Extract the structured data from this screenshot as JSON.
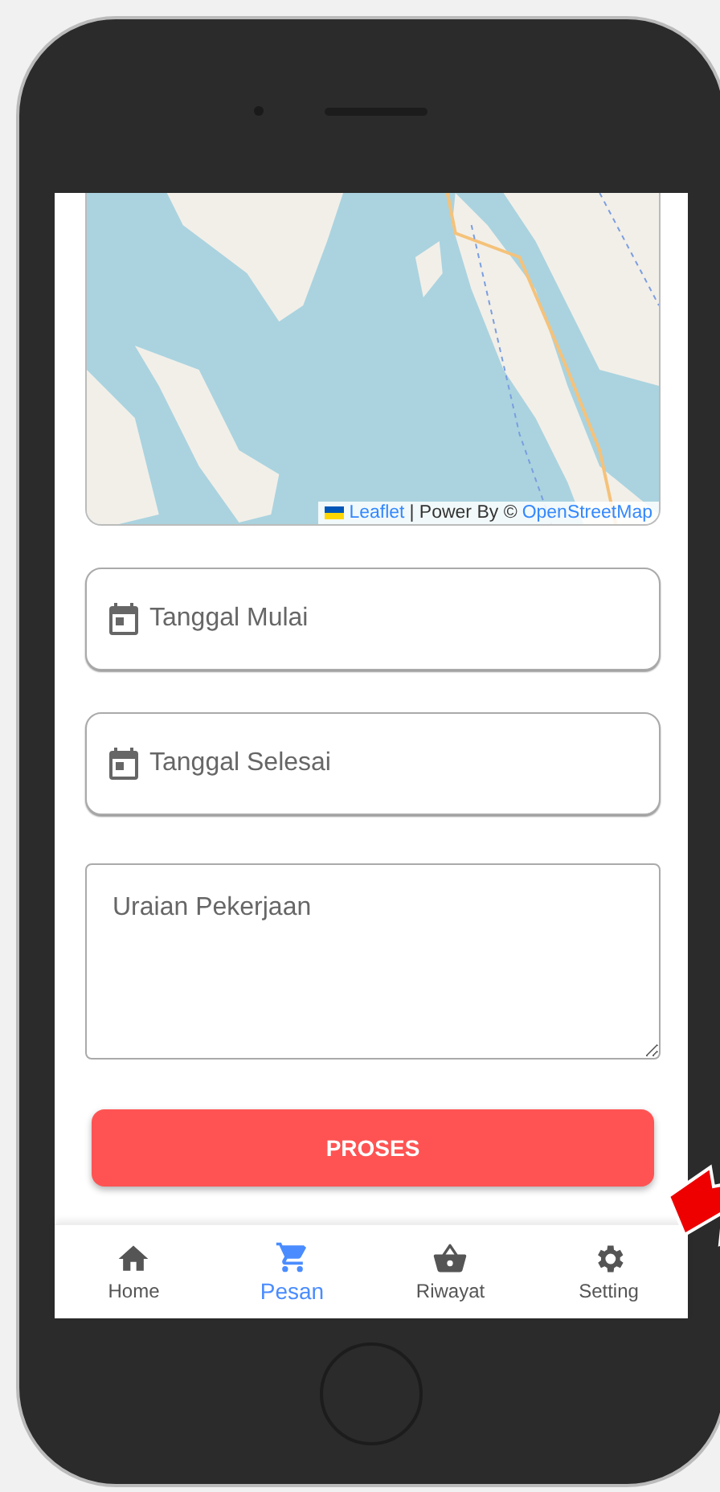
{
  "map": {
    "kind": "picture",
    "attribution": {
      "link": "Leaflet",
      "text": "| Power By ©",
      "source": "OpenStreetMap"
    }
  },
  "fields": [
    {
      "kind": "date",
      "placeholder": "Tanggal Mulai"
    },
    {
      "kind": "date",
      "placeholder": "Tanggal Selesai"
    },
    {
      "kind": "textarea",
      "placeholder": "Uraian Pekerjaan"
    }
  ],
  "submit": "PROSES",
  "nav": [
    {
      "kind": "home",
      "label": "Home",
      "selected": false
    },
    {
      "kind": "cart",
      "label": "Pesan",
      "selected": true
    },
    {
      "kind": "basket",
      "label": "Riwayat",
      "selected": false
    },
    {
      "kind": "gear",
      "label": "Setting",
      "selected": false
    }
  ]
}
